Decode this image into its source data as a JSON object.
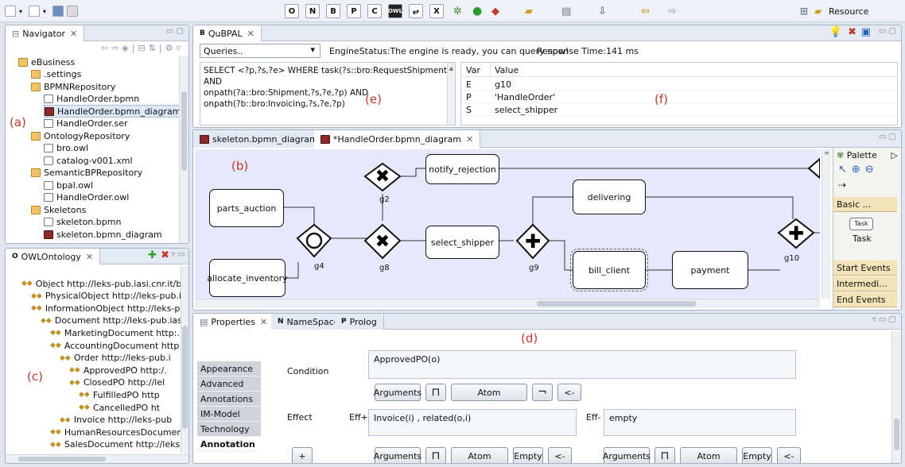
{
  "toolbar": {
    "resource_label": "Resource",
    "tools": [
      "O",
      "N",
      "B",
      "P",
      "C",
      "OWL",
      "⥂",
      "X"
    ]
  },
  "navigator": {
    "title": "Navigator",
    "items": [
      {
        "label": "eBusiness",
        "kind": "project"
      },
      {
        "label": ".settings",
        "kind": "folder"
      },
      {
        "label": "BPMNRepository",
        "kind": "folder"
      },
      {
        "label": "HandleOrder.bpmn",
        "kind": "file"
      },
      {
        "label": "HandleOrder.bpmn_diagram",
        "kind": "diagram",
        "selected": true
      },
      {
        "label": "HandleOrder.ser",
        "kind": "file"
      },
      {
        "label": "OntologyRepository",
        "kind": "folder"
      },
      {
        "label": "bro.owl",
        "kind": "file"
      },
      {
        "label": "catalog-v001.xml",
        "kind": "file"
      },
      {
        "label": "SemanticBPRepository",
        "kind": "folder"
      },
      {
        "label": "bpal.owl",
        "kind": "file"
      },
      {
        "label": "HandleOrder.owl",
        "kind": "file"
      },
      {
        "label": "Skeletons",
        "kind": "folder"
      },
      {
        "label": "skeleton.bpmn",
        "kind": "file"
      },
      {
        "label": "skeleton.bpmn_diagram",
        "kind": "diagram"
      }
    ]
  },
  "owl": {
    "title": "OWLOntology",
    "items": [
      "Object  http://leks-pub.iasi.cnr.it/bro.o",
      "PhysicalObject  http://leks-pub.ias",
      "InformationObject  http://leks-pul",
      "Document  http://leks-pub.iasi",
      "MarketingDocument  http:.",
      "AccountingDocument  http",
      "Order  http://leks-pub.i",
      "ApprovedPO  http:/.",
      "ClosedPO  http://lel",
      "FulfilledPO  http",
      "CancelledPO  ht",
      "Invoice  http://leks-pub",
      "HumanResourcesDocumen",
      "SalesDocument  http://leks"
    ]
  },
  "qubpal": {
    "title": "QuBPAL",
    "queries": "Queries..",
    "status": "EngineStatus:The engine is ready, you can query now!",
    "response": "Response Time:141 ms",
    "query": [
      "SELECT <?p,?s,?e> WHERE task(?s::bro:RequestShipment) AND",
      "onpath(?a::bro:Shipment,?s,?e,?p) AND",
      "onpath(?b::bro:Invoicing,?s,?e,?p)"
    ],
    "columns": [
      "Var",
      "Value"
    ],
    "rows": [
      [
        "E",
        "g10"
      ],
      [
        "P",
        "'HandleOrder'"
      ],
      [
        "S",
        "select_shipper"
      ]
    ]
  },
  "editor": {
    "tabs": [
      "skeleton.bpmn_diagram",
      "*HandleOrder.bpmn_diagram"
    ],
    "tasks": {
      "notify": "notify_rejection",
      "parts": "parts_auction",
      "allocate": "allocate_inventory",
      "select": "select_shipper",
      "delivering": "delivering",
      "bill": "bill_client",
      "payment": "payment"
    },
    "gateways": {
      "g2": "g2",
      "g4": "g4",
      "g8": "g8",
      "g9": "g9",
      "g10": "g10"
    }
  },
  "palette": {
    "title": "Palette",
    "basic": "Basic ...",
    "task_label": "Task",
    "task_icon_label": "Task",
    "start": "Start Events",
    "inter": "Intermedi...",
    "end": "End Events"
  },
  "props": {
    "tabs": [
      "Properties",
      "NameSpace",
      "Prolog"
    ],
    "side": [
      "Appearance",
      "Advanced",
      "Annotations",
      "IM-Model",
      "Technology",
      "Annotation"
    ],
    "condition_label": "Condition",
    "condition_value": "ApprovedPO(o)",
    "effect_label": "Effect",
    "effplus": "Eff+",
    "effplus_value": "Invoice(i) , related(o,i)",
    "effminus": "Eff-",
    "effminus_value": "empty",
    "arguments": "Arguments",
    "atom": "Atom",
    "empty": "Empty",
    "not": "¬",
    "back": "<-",
    "plus": "+",
    "open": "⊓"
  },
  "labels": {
    "a": "(a)",
    "b": "(b)",
    "c": "(c)",
    "d": "(d)",
    "e": "(e)",
    "f": "(f)"
  },
  "colors": {
    "canvas": "#e6e8fb",
    "accent": "#c0392b"
  }
}
